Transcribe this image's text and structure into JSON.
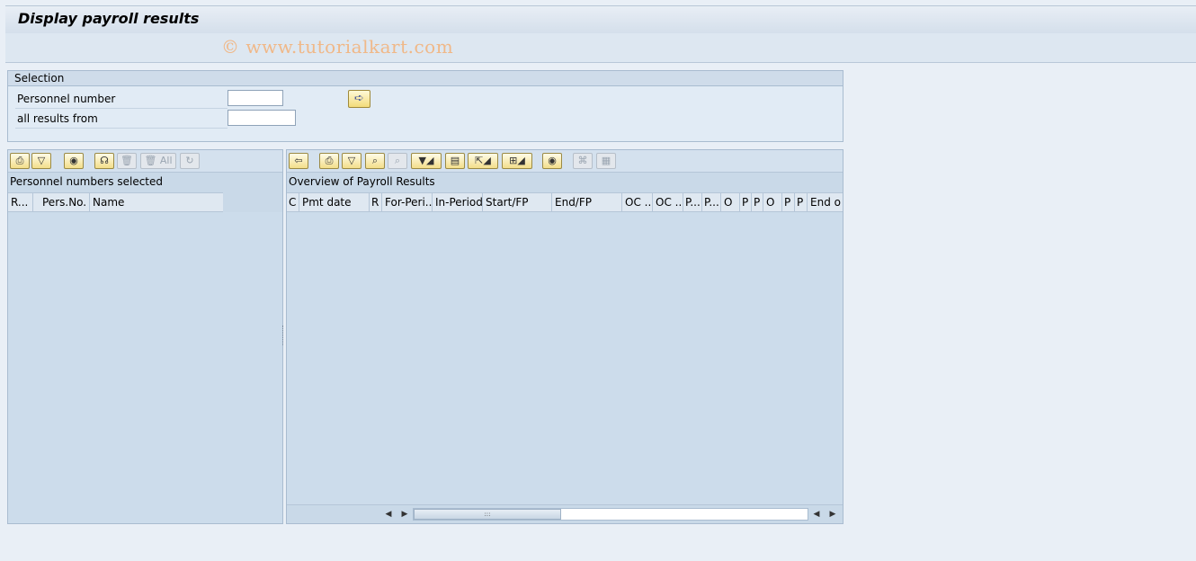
{
  "window": {
    "title": "Display payroll results"
  },
  "watermark": "© www.tutorialkart.com",
  "selection": {
    "heading": "Selection",
    "fields": [
      {
        "label": "Personnel number",
        "value": ""
      },
      {
        "label": "all results from",
        "value": ""
      }
    ],
    "execute_icon": "arrow-right-icon"
  },
  "left_panel": {
    "toolbar": {
      "buttons": [
        "print-icon",
        "filter-icon",
        "layout-icon",
        "select-icon",
        "delete-icon",
        "delete-all-icon",
        "refresh-icon"
      ],
      "delete_all_label": "All"
    },
    "title": "Personnel numbers selected",
    "columns": [
      "R...",
      "Pers.No.",
      "Name"
    ]
  },
  "right_panel": {
    "toolbar": {
      "buttons": [
        "back-icon",
        "print-icon",
        "filter-icon",
        "find-icon",
        "find-next-icon",
        "set-filter-icon",
        "print-preview-icon",
        "export-icon",
        "layout-select-icon",
        "layout-icon",
        "details-icon",
        "columns-icon"
      ]
    },
    "title": "Overview of Payroll Results",
    "columns": [
      "C",
      "Pmt date",
      "R",
      "For-Peri...",
      "In-Period",
      "Start/FP",
      "End/FP",
      "OC ...",
      "OC ...",
      "P...",
      "P...",
      "O",
      "P",
      "P",
      "O",
      "P",
      "P",
      "End o"
    ]
  }
}
